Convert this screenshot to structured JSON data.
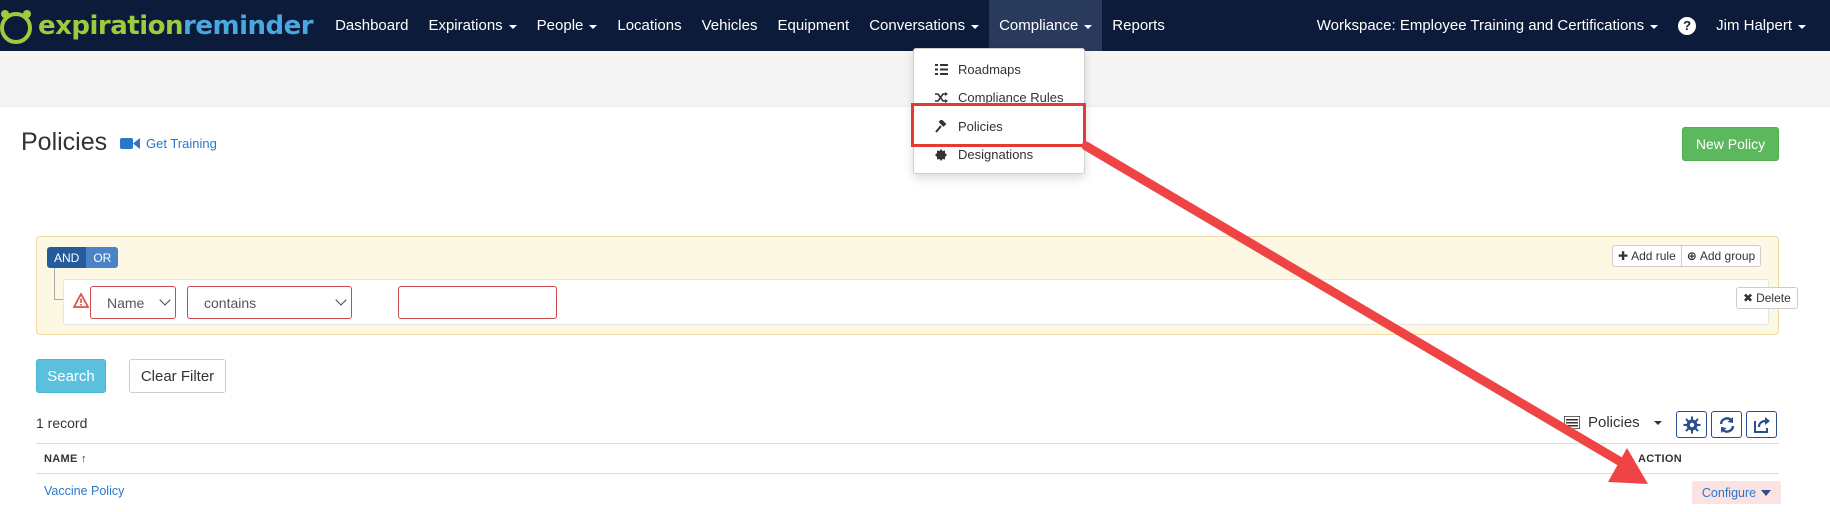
{
  "app": {
    "logo_part1": "expiration",
    "logo_part2": "reminder",
    "nav": [
      {
        "label": "Dashboard",
        "caret": false
      },
      {
        "label": "Expirations",
        "caret": true
      },
      {
        "label": "People",
        "caret": true
      },
      {
        "label": "Locations",
        "caret": false
      },
      {
        "label": "Vehicles",
        "caret": false
      },
      {
        "label": "Equipment",
        "caret": false
      },
      {
        "label": "Conversations",
        "caret": true
      },
      {
        "label": "Compliance",
        "caret": true
      },
      {
        "label": "Reports",
        "caret": false
      }
    ],
    "workspace": "Workspace: Employee Training and Certifications",
    "help": "?",
    "user": "Jim Halpert"
  },
  "compliance_menu": [
    {
      "label": "Roadmaps",
      "icon": "roadmap-icon"
    },
    {
      "label": "Compliance Rules",
      "icon": "shuffle-icon"
    },
    {
      "label": "Policies",
      "icon": "gavel-icon"
    },
    {
      "label": "Designations",
      "icon": "badge-icon"
    }
  ],
  "page": {
    "title": "Policies",
    "get_training": "Get Training",
    "new_button": "New Policy"
  },
  "query_builder": {
    "and_label": "AND",
    "or_label": "OR",
    "add_rule": "Add rule",
    "add_group": "Add group",
    "delete": "Delete",
    "field_value": "Name",
    "operator_value": "contains",
    "text_value": ""
  },
  "filters": {
    "search": "Search",
    "clear": "Clear Filter"
  },
  "results": {
    "count": "1 record",
    "view": "Policies",
    "columns": {
      "name": "NAME ↑",
      "action": "ACTION"
    },
    "rows": [
      {
        "name": "Vaccine Policy",
        "action": "Configure"
      }
    ]
  },
  "colors": {
    "nav_bg": "#0c1b3a",
    "accent_green": "#5cb85c",
    "search_blue": "#5bc0de",
    "link_blue": "#2a77c9",
    "annotation_red": "#e53935"
  }
}
